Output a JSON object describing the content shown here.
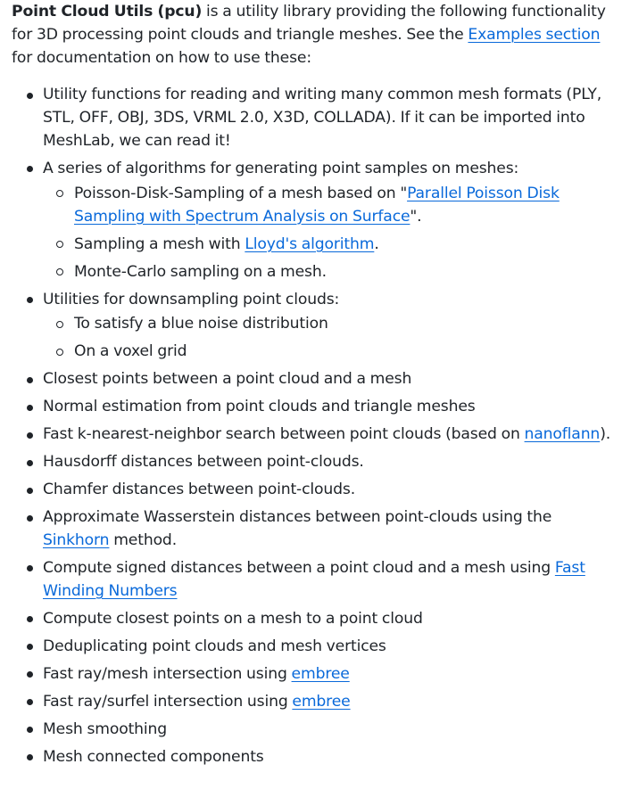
{
  "intro": {
    "title": "Point Cloud Utils (pcu)",
    "text_1": " is a utility library providing the following functionality for 3D processing point clouds and triangle meshes. See the ",
    "examples_link": "Examples section",
    "text_2": " for documentation on how to use these:"
  },
  "items": [
    {
      "text": "Utility functions for reading and writing many common mesh formats (PLY, STL, OFF, OBJ, 3DS, VRML 2.0, X3D, COLLADA). If it can be imported into MeshLab, we can read it!"
    },
    {
      "text": "A series of algorithms for generating point samples on meshes:",
      "sub": [
        {
          "pre": "Poisson-Disk-Sampling of a mesh based on \"",
          "link": "Parallel Poisson Disk Sampling with Spectrum Analysis on Surface",
          "post": "\"."
        },
        {
          "pre": "Sampling a mesh with ",
          "link": "Lloyd's algorithm",
          "post": "."
        },
        {
          "pre": "Monte-Carlo sampling on a mesh."
        }
      ]
    },
    {
      "text": "Utilities for downsampling point clouds:",
      "sub": [
        {
          "pre": "To satisfy a blue noise distribution"
        },
        {
          "pre": "On a voxel grid"
        }
      ]
    },
    {
      "text": "Closest points between a point cloud and a mesh"
    },
    {
      "text": "Normal estimation from point clouds and triangle meshes"
    },
    {
      "text": "Fast k-nearest-neighbor search between point clouds (based on ",
      "link": "nanoflann",
      "post": ")."
    },
    {
      "text": "Hausdorff distances between point-clouds."
    },
    {
      "text": "Chamfer distances between point-clouds."
    },
    {
      "text": "Approximate Wasserstein distances between point-clouds using the ",
      "link": "Sinkhorn",
      "post": " method."
    },
    {
      "text": "Compute signed distances between a point cloud and a mesh using ",
      "link": "Fast Winding Numbers",
      "post": ""
    },
    {
      "text": "Compute closest points on a mesh to a point cloud"
    },
    {
      "text": "Deduplicating point clouds and mesh vertices"
    },
    {
      "text": "Fast ray/mesh intersection using ",
      "link": "embree",
      "post": ""
    },
    {
      "text": "Fast ray/surfel intersection using ",
      "link": "embree",
      "post": ""
    },
    {
      "text": "Mesh smoothing"
    },
    {
      "text": "Mesh connected components"
    }
  ]
}
